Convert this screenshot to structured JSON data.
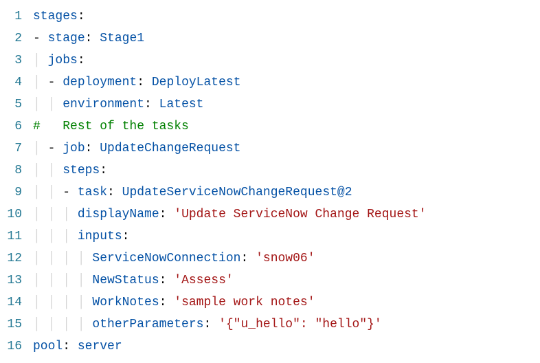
{
  "lines": {
    "1": "1",
    "2": "2",
    "3": "3",
    "4": "4",
    "5": "5",
    "6": "6",
    "7": "7",
    "8": "8",
    "9": "9",
    "10": "10",
    "11": "11",
    "12": "12",
    "13": "13",
    "14": "14",
    "15": "15",
    "16": "16"
  },
  "tokens": {
    "stages": "stages",
    "stage": "stage",
    "Stage1": "Stage1",
    "jobs": "jobs",
    "deployment": "deployment",
    "DeployLatest": "DeployLatest",
    "environment": "environment",
    "Latest": "Latest",
    "comment": "#   Rest of the tasks",
    "job": "job",
    "UpdateChangeRequest": "UpdateChangeRequest",
    "steps": "steps",
    "task": "task",
    "UpdateServiceNowChangeRequest2": "UpdateServiceNowChangeRequest@2",
    "displayName": "displayName",
    "displayNameValue": "'Update ServiceNow Change Request'",
    "inputs": "inputs",
    "ServiceNowConnection": "ServiceNowConnection",
    "ServiceNowConnectionValue": "'snow06'",
    "NewStatus": "NewStatus",
    "NewStatusValue": "'Assess'",
    "WorkNotes": "WorkNotes",
    "WorkNotesValue": "'sample work notes'",
    "otherParameters": "otherParameters",
    "otherParametersValue": "'{\"u_hello\": \"hello\"}'",
    "pool": "pool",
    "server": "server",
    "colon": ":",
    "dash": "- ",
    "space": " "
  }
}
